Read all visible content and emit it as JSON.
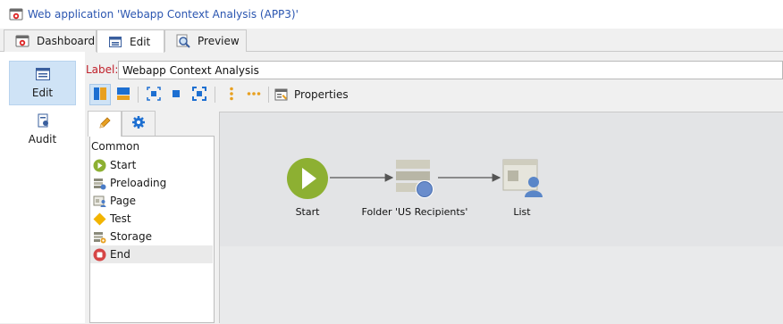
{
  "window": {
    "title": "Web application 'Webapp Context Analysis (APP3)'"
  },
  "tabs": [
    {
      "label": "Dashboard",
      "icon": "dashboard-icon",
      "active": false
    },
    {
      "label": "Edit",
      "icon": "edit-form-icon",
      "active": true
    },
    {
      "label": "Preview",
      "icon": "magnifier-icon",
      "active": false
    }
  ],
  "leftnav": [
    {
      "label": "Edit",
      "icon": "edit-form-icon",
      "active": true
    },
    {
      "label": "Audit",
      "icon": "audit-icon",
      "active": false
    }
  ],
  "label_field": {
    "label": "Label:",
    "value": "Webapp Context Analysis"
  },
  "toolbar": {
    "properties_label": "Properties"
  },
  "palette": {
    "group": "Common",
    "items": [
      {
        "label": "Start",
        "icon": "start-play-icon"
      },
      {
        "label": "Preloading",
        "icon": "preloading-icon"
      },
      {
        "label": "Page",
        "icon": "page-icon"
      },
      {
        "label": "Test",
        "icon": "test-diamond-icon"
      },
      {
        "label": "Storage",
        "icon": "storage-icon"
      },
      {
        "label": "End",
        "icon": "end-stop-icon"
      }
    ]
  },
  "workflow": {
    "nodes": [
      {
        "label": "Start",
        "icon": "start-play-icon"
      },
      {
        "label": "Folder 'US Recipients'",
        "icon": "folder-recipients-icon"
      },
      {
        "label": "List",
        "icon": "list-page-icon"
      }
    ]
  },
  "colors": {
    "accent_blue": "#2a55b0",
    "label_red": "#c0202a",
    "start_green": "#8db032",
    "toolbar_orange": "#e8a020"
  }
}
